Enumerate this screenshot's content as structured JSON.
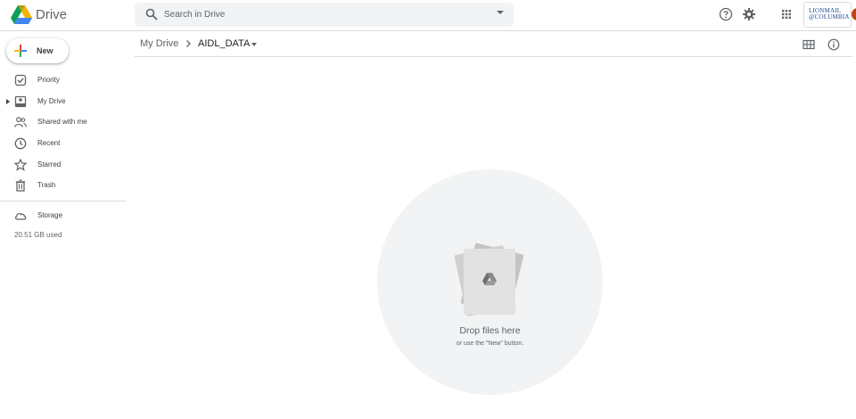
{
  "app": {
    "name": "Drive"
  },
  "search": {
    "placeholder": "Search in Drive"
  },
  "header": {
    "icons": [
      "help-icon",
      "settings-icon",
      "apps-icon"
    ],
    "org_logo": {
      "line1": "LIONMAIL",
      "line2": "@COLUMBIA"
    }
  },
  "sidebar": {
    "new_label": "New",
    "items": [
      {
        "label": "Priority",
        "icon": "priority-icon"
      },
      {
        "label": "My Drive",
        "icon": "my-drive-icon"
      },
      {
        "label": "Shared with me",
        "icon": "shared-icon"
      },
      {
        "label": "Recent",
        "icon": "clock-icon"
      },
      {
        "label": "Starred",
        "icon": "star-icon"
      },
      {
        "label": "Trash",
        "icon": "trash-icon"
      }
    ],
    "storage": {
      "label": "Storage",
      "used": "20.51 GB used"
    }
  },
  "breadcrumb": {
    "root": "My Drive",
    "current": "AIDL_DATA"
  },
  "empty_state": {
    "title": "Drop files here",
    "subtitle": "or use the \"New\" button."
  },
  "colors": {
    "blue": "#4285f4",
    "green": "#0f9d58",
    "yellow": "#f4b400",
    "red": "#db4437",
    "icon_gray": "#5f6368",
    "surface": "#f1f3f4",
    "org_blue": "#1d4f91"
  }
}
